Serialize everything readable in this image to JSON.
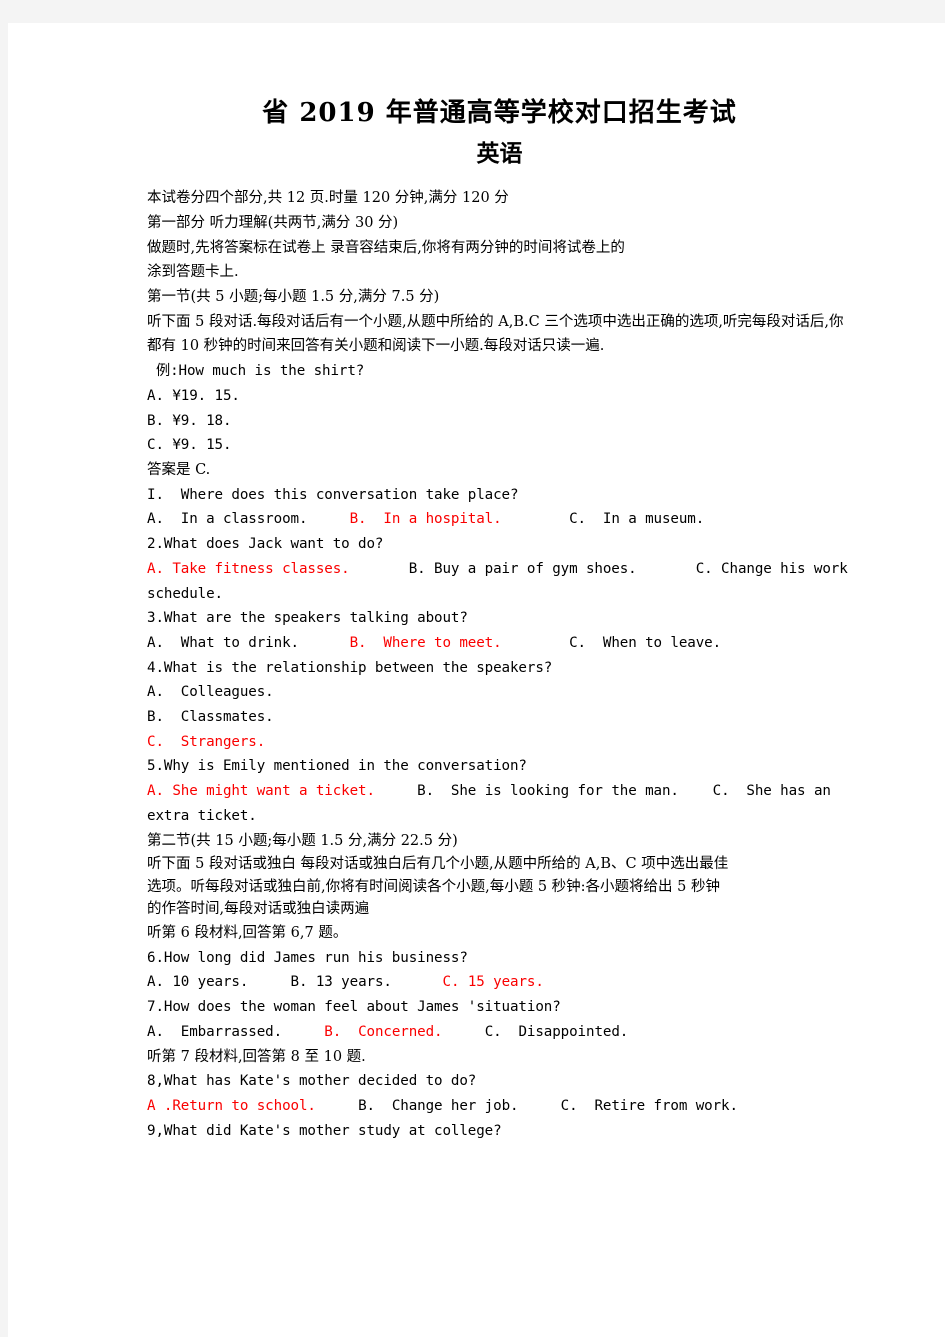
{
  "document": {
    "title": "省 2019 年普通高等学校对口招生考试",
    "subtitle": "英语",
    "accent_color": "#fa0000"
  },
  "intro": {
    "line_1": "本试卷分四个部分,共 12 页.时量 120 分钟,满分 120 分",
    "line_2": "第一部分 听力理解(共两节,满分 30 分)",
    "line_3": "做题时,先将答案标在试卷上 录音容结束后,你将有两分钟的时间将试卷上的",
    "line_4": "涂到答题卡上."
  },
  "section_one": {
    "heading": "第一节(共 5 小题;每小题 1.5 分,满分 7.5 分)",
    "instructions": "听下面 5 段对话.每段对话后有一个小题,从题中所给的 A,B.C 三个选项中选出正确的选项,听完每段对话后,你都有 10 秒钟的时间来回答有关小题和阅读下一小题.每段对话只读一遍.",
    "example": {
      "question": "例:How much is the shirt?",
      "options": [
        "A. ¥19. 15.",
        "B. ¥9. 18.",
        "C. ¥9. 15."
      ],
      "answer_line": "答案是 C."
    },
    "questions": [
      {
        "number": "I.",
        "text": "I.  Where does this conversation take place?",
        "options": [
          {
            "text": "A.  In a classroom.",
            "correct": false
          },
          {
            "text": "B.  In a hospital.",
            "correct": true
          },
          {
            "text": "C.  In a museum.",
            "correct": false
          }
        ]
      },
      {
        "number": "2.",
        "text": "2.What does Jack want to do?",
        "options": [
          {
            "text": "A. Take fitness classes.",
            "correct": true
          },
          {
            "text": "B. Buy a pair of gym shoes.",
            "correct": false
          },
          {
            "text": "C. Change his work schedule.",
            "correct": false
          }
        ]
      },
      {
        "number": "3.",
        "text": "3.What are the speakers talking about?",
        "options": [
          {
            "text": "A.  What to drink.",
            "correct": false
          },
          {
            "text": "B.  Where to meet.",
            "correct": true
          },
          {
            "text": "C.  When to leave.",
            "correct": false
          }
        ]
      },
      {
        "number": "4.",
        "text": "4.What is the relationship between the speakers?",
        "options": [
          {
            "text": "A.  Colleagues.",
            "correct": false
          },
          {
            "text": "B.  Classmates.",
            "correct": false
          },
          {
            "text": "C.  Strangers.",
            "correct": true
          }
        ]
      },
      {
        "number": "5.",
        "text": "5.Why is Emily mentioned in the conversation?",
        "options": [
          {
            "text": "A. She might want a ticket.",
            "correct": true
          },
          {
            "text": "B.  She is looking for the man.",
            "correct": false
          },
          {
            "text": "C.  She has an extra ticket.",
            "correct": false
          }
        ]
      }
    ]
  },
  "section_two": {
    "heading": "第二节(共 15 小题;每小题 1.5 分,满分 22.5 分)",
    "instructions_1": "听下面 5 段对话或独白 每段对话或独白后有几个小题,从题中所给的 A,B、C 项中选出最佳",
    "instructions_2": "选项。听每段对话或独白前,你将有时间阅读各个小题,每小题 5 秒钟:各小题将给出 5 秒钟",
    "instructions_3": "的作答时间,每段对话或独白读两遍",
    "material_6": "听第 6 段材料,回答第 6,7 题。",
    "material_7": "听第 7 段材料,回答第 8 至 10 题.",
    "questions": [
      {
        "number": "6.",
        "text": "6.How long did James run his business?",
        "options_inline": [
          {
            "text": "A. 10 years.",
            "correct": false
          },
          {
            "text": "B. 13 years.",
            "correct": false
          },
          {
            "text": "C. 15 years.",
            "correct": true
          }
        ]
      },
      {
        "number": "7.",
        "text": "7.How does the woman feel about James 'situation?",
        "options_inline": [
          {
            "text": "A.  Embarrassed.",
            "correct": false
          },
          {
            "text": "B.  Concerned.",
            "correct": true
          },
          {
            "text": "C.  Disappointed.",
            "correct": false
          }
        ]
      },
      {
        "number": "8,",
        "text": "8,What has Kate's mother decided to do?",
        "options_inline": [
          {
            "text": "A .Return to school.",
            "correct": true
          },
          {
            "text": "B.  Change her job.",
            "correct": false
          },
          {
            "text": "C.  Retire from work.",
            "correct": false
          }
        ]
      },
      {
        "number": "9,",
        "text": "9,What did Kate's mother study at college?",
        "options_inline": []
      }
    ]
  }
}
